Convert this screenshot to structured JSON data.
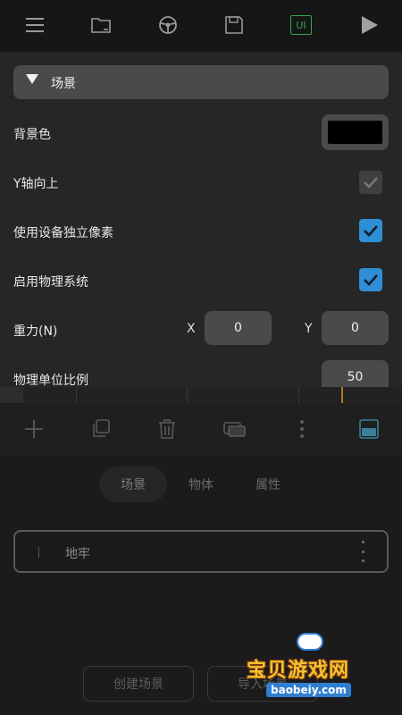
{
  "toolbar": {
    "icons": [
      "menu-icon",
      "folder-icon",
      "steering-wheel-icon",
      "save-icon",
      "ui-icon",
      "play-icon"
    ],
    "ui_label": "UI"
  },
  "scene_section": {
    "title": "场景",
    "background_color_label": "背景色",
    "background_color": "#000000",
    "y_axis_up_label": "Y轴向上",
    "y_axis_up_checked": true,
    "use_device_pixels_label": "使用设备独立像素",
    "use_device_pixels_checked": true,
    "enable_physics_label": "启用物理系统",
    "enable_physics_checked": true,
    "gravity_label": "重力(N)",
    "gravity_x_label": "X",
    "gravity_x": "0",
    "gravity_y_label": "Y",
    "gravity_y": "0",
    "physics_unit_label": "物理单位比例",
    "physics_unit": "50"
  },
  "bottom_toolbar": {
    "icons": [
      "add-icon",
      "duplicate-icon",
      "trash-icon",
      "layers-icon",
      "more-vertical-icon",
      "panel-toggle-icon"
    ]
  },
  "tabs": [
    {
      "label": "场景",
      "active": true
    },
    {
      "label": "物体",
      "active": false
    },
    {
      "label": "属性",
      "active": false
    }
  ],
  "scene_list": [
    {
      "label": "地牢"
    }
  ],
  "actions": {
    "create_scene": "创建场景",
    "import_scene": "导入场景"
  },
  "watermark": {
    "title": "宝贝游戏网",
    "url": "baobeiy.com"
  },
  "colors": {
    "accent_blue": "#2e8ed6",
    "ui_green": "#2fa84f",
    "panel": "#262626"
  }
}
